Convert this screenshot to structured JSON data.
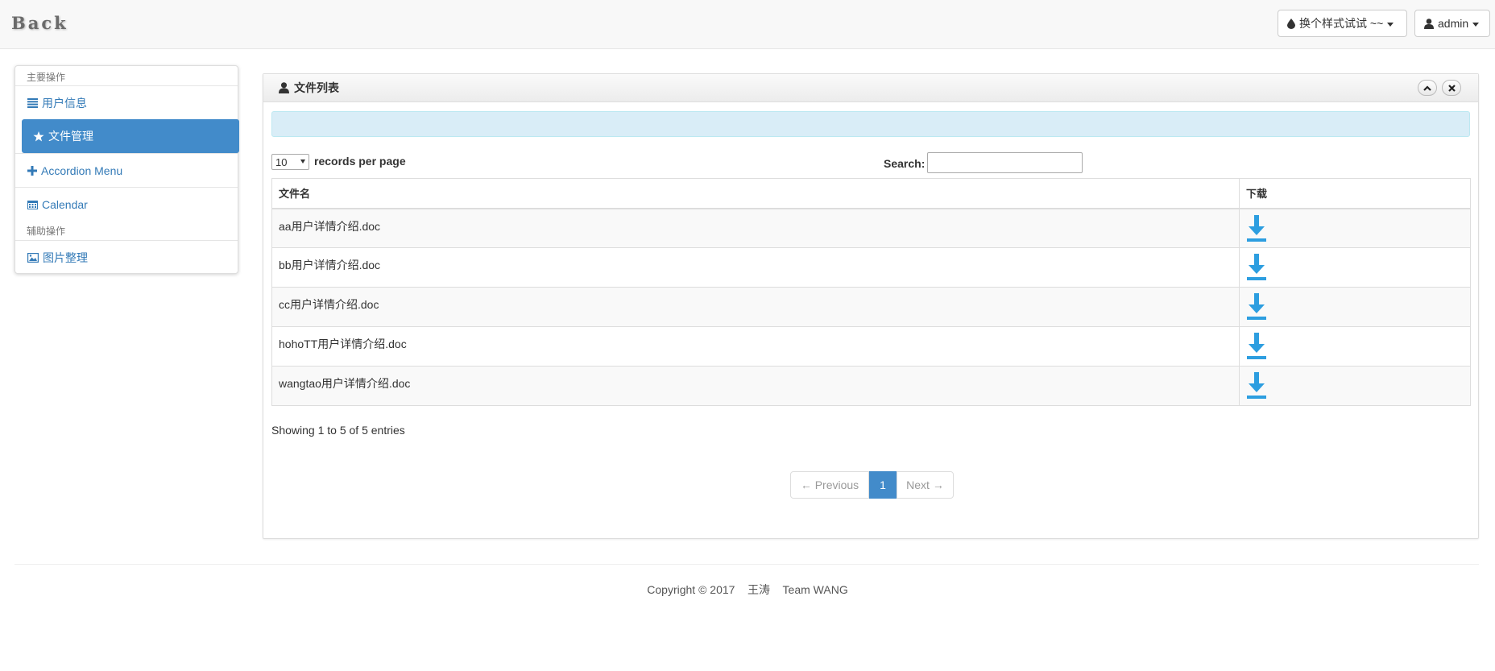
{
  "navbar": {
    "brand": "Back",
    "style_switcher_label": "换个样式试试 ~~",
    "user_label": "admin"
  },
  "sidebar": {
    "main_header": "主要操作",
    "aux_header": "辅助操作",
    "items": [
      {
        "label": "用户信息",
        "icon": "list-icon"
      },
      {
        "label": "文件管理",
        "icon": "star-icon",
        "active": true
      },
      {
        "label": "Accordion Menu",
        "icon": "plus-icon"
      },
      {
        "label": "Calendar",
        "icon": "calendar-icon"
      },
      {
        "label": "图片整理",
        "icon": "picture-icon"
      }
    ]
  },
  "panel": {
    "title": "文件列表",
    "length_value": "10",
    "length_label": "records per page",
    "search_label": "Search:",
    "search_value": "",
    "columns": [
      "文件名",
      "下载"
    ],
    "rows": [
      {
        "name": "aa用户详情介绍.doc"
      },
      {
        "name": "bb用户详情介绍.doc"
      },
      {
        "name": "cc用户详情介绍.doc"
      },
      {
        "name": "hohoTT用户详情介绍.doc"
      },
      {
        "name": "wangtao用户详情介绍.doc"
      }
    ],
    "info": "Showing 1 to 5 of 5 entries",
    "pagination": {
      "prev": "← Previous",
      "current": "1",
      "next": "Next →"
    }
  },
  "footer": {
    "text": "Copyright © 2017    王涛    Team WANG"
  },
  "colors": {
    "accent": "#428bca",
    "link": "#337ab7",
    "download": "#2d9ee0",
    "alert_bg": "#d9edf7"
  }
}
